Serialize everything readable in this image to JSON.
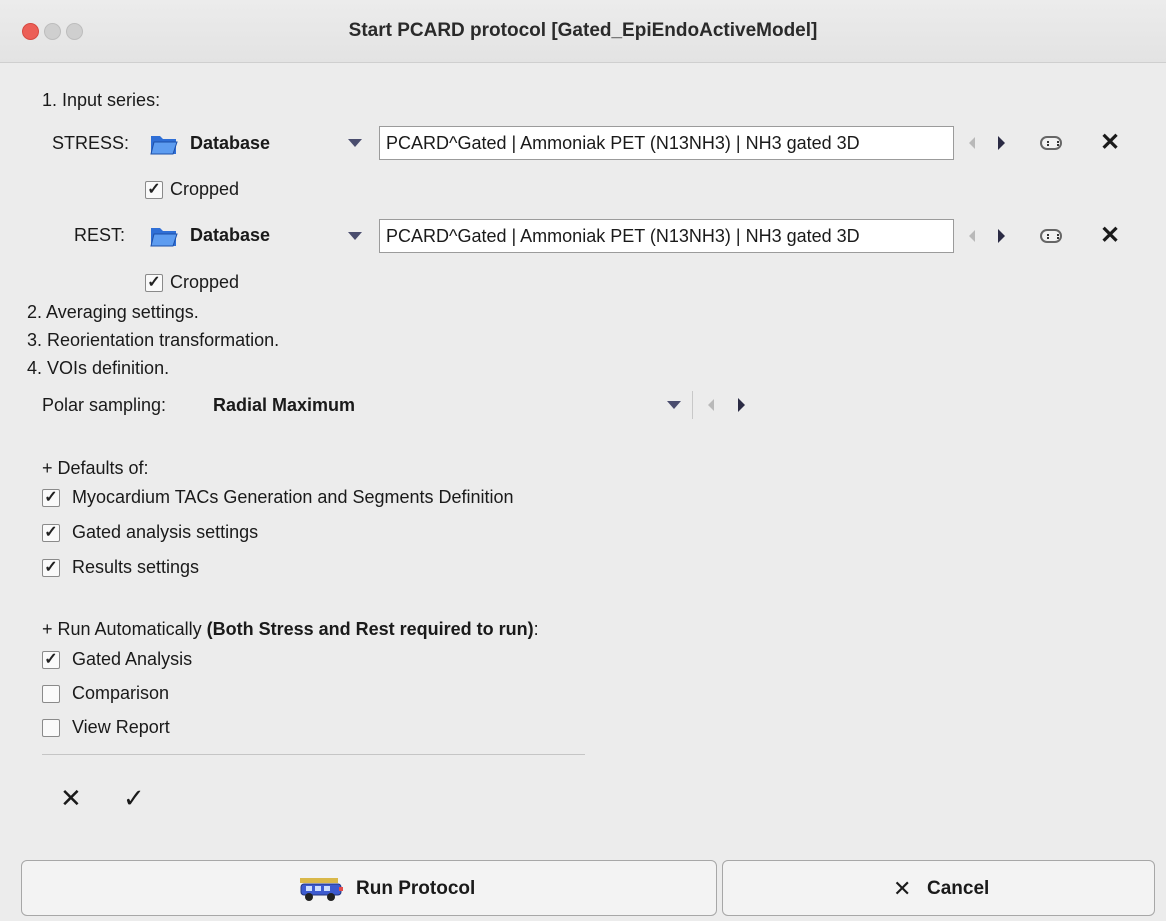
{
  "window": {
    "title": "Start PCARD protocol [Gated_EpiEndoActiveModel]"
  },
  "input": {
    "heading": "1. Input series:",
    "stress": {
      "label": "STRESS:",
      "source": "Database",
      "series": "PCARD^Gated | Ammoniak PET (N13NH3) | NH3 gated 3D",
      "cropped_label": "Cropped",
      "cropped": true
    },
    "rest": {
      "label": "REST:",
      "source": "Database",
      "series": "PCARD^Gated | Ammoniak PET (N13NH3) | NH3 gated 3D",
      "cropped_label": "Cropped",
      "cropped": true
    }
  },
  "steps": {
    "averaging": "2. Averaging settings.",
    "reorientation": "3. Reorientation transformation.",
    "vois": "4. VOIs definition."
  },
  "polar": {
    "label": "Polar sampling:",
    "value": "Radial Maximum"
  },
  "defaults": {
    "heading": "+ Defaults of:",
    "items": [
      {
        "label": "Myocardium TACs Generation and Segments Definition",
        "checked": true
      },
      {
        "label": "Gated analysis settings",
        "checked": true
      },
      {
        "label": "Results settings",
        "checked": true
      }
    ]
  },
  "run_auto": {
    "heading_prefix": "+ Run Automatically ",
    "heading_bold": "(Both Stress and Rest required to run)",
    "heading_suffix": ":",
    "items": [
      {
        "label": "Gated Analysis",
        "checked": true
      },
      {
        "label": "Comparison",
        "checked": false
      },
      {
        "label": "View Report",
        "checked": false
      }
    ]
  },
  "toolbar": {
    "clear_symbol": "✕",
    "ok_symbol": "✓"
  },
  "buttons": {
    "run": "Run Protocol",
    "cancel": "Cancel",
    "cancel_symbol": "✕"
  },
  "colors": {
    "folder": "#2f6fd6",
    "close_red": "#ec5f57"
  }
}
